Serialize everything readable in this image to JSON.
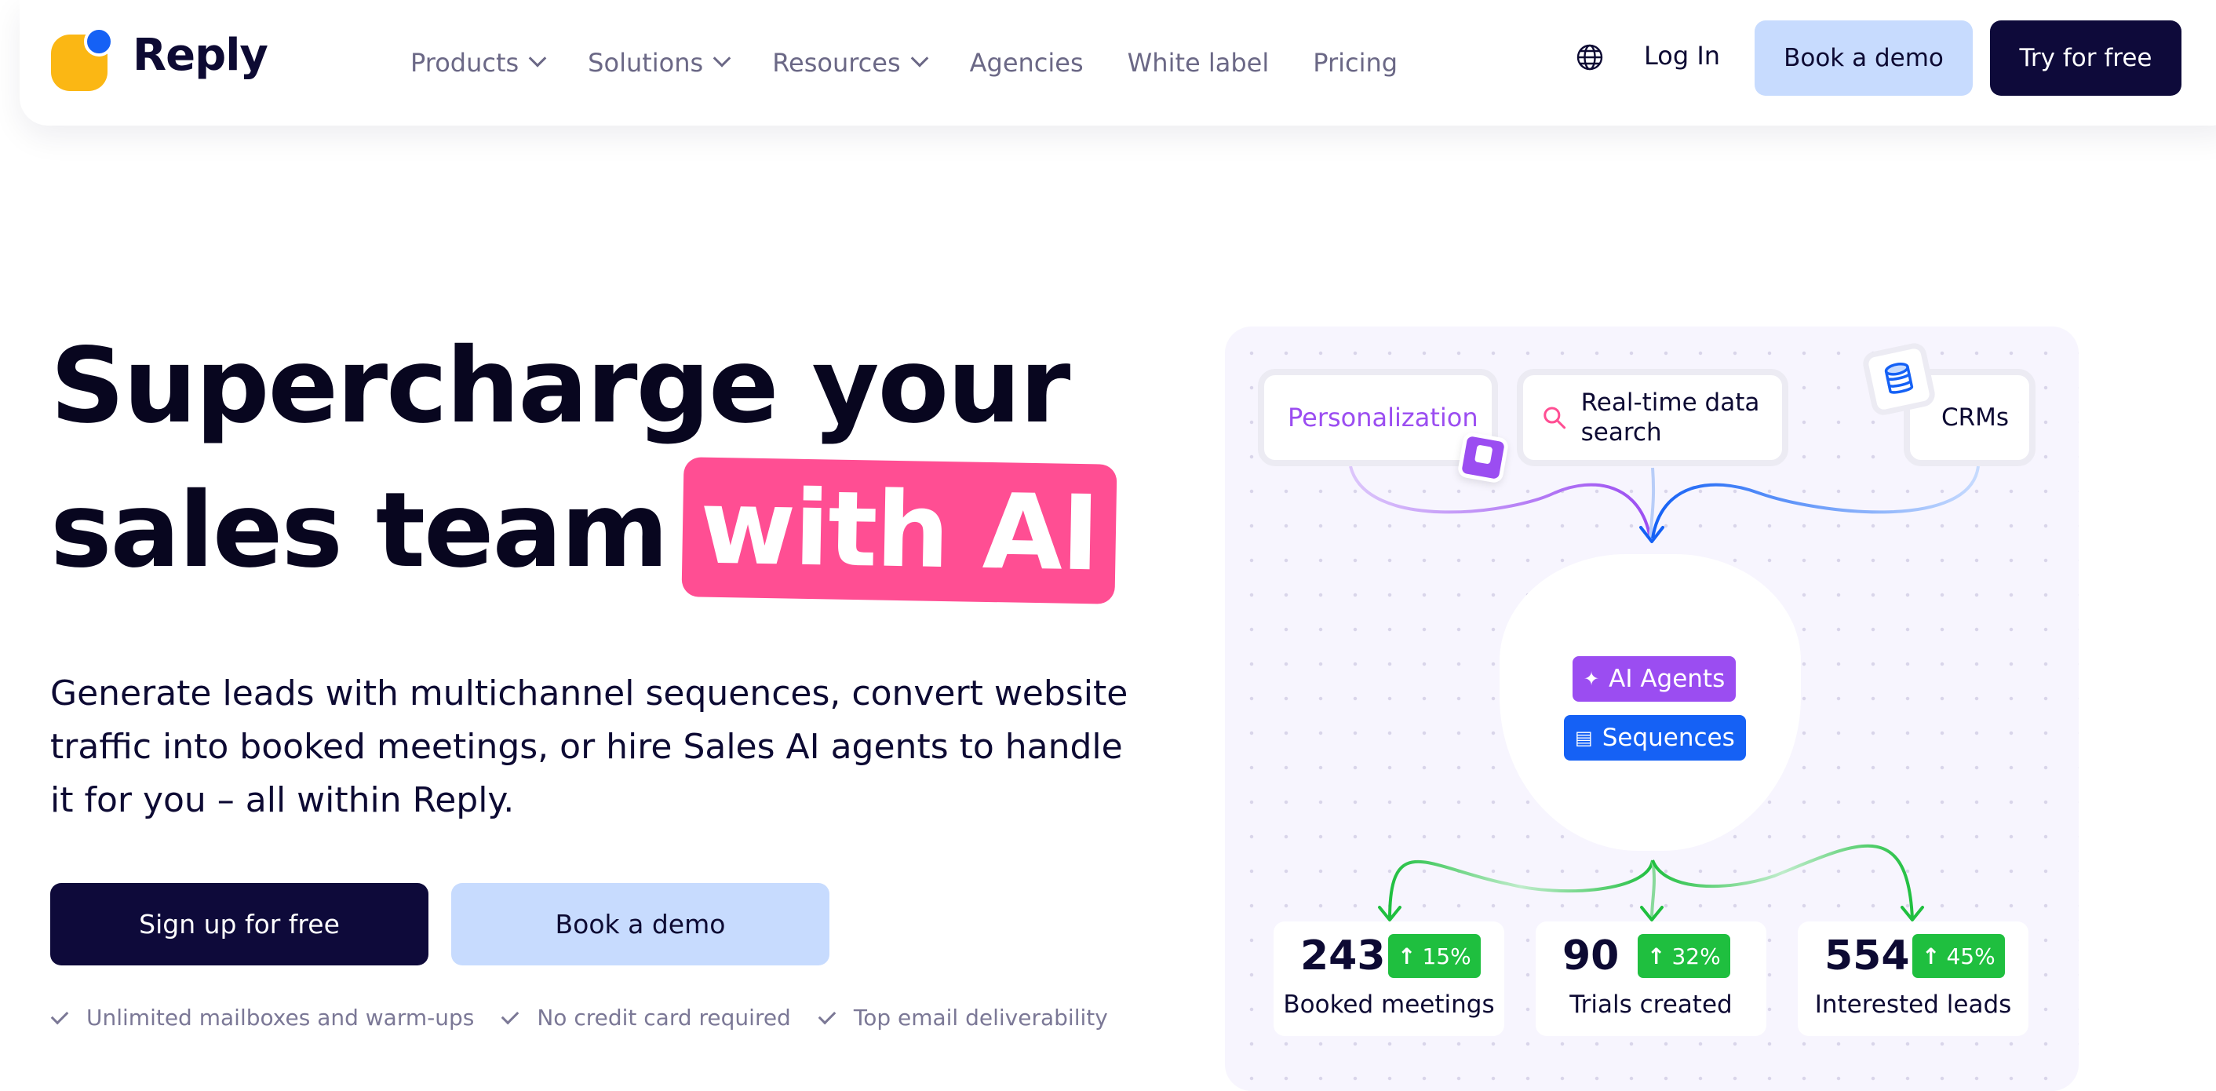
{
  "brand": {
    "name": "Reply",
    "logo_colors": {
      "yellow": "#fbb714",
      "blue": "#1561f5"
    }
  },
  "nav": {
    "items": [
      {
        "label": "Products",
        "has_dropdown": true
      },
      {
        "label": "Solutions",
        "has_dropdown": true
      },
      {
        "label": "Resources",
        "has_dropdown": true
      },
      {
        "label": "Agencies",
        "has_dropdown": false
      },
      {
        "label": "White label",
        "has_dropdown": false
      },
      {
        "label": "Pricing",
        "has_dropdown": false
      }
    ],
    "language_icon": "globe-icon",
    "login_label": "Log In",
    "demo_label": "Book a demo",
    "try_label": "Try for free"
  },
  "hero": {
    "title_line1": "Supercharge your",
    "title_line2": "sales team",
    "title_highlight": "with AI",
    "subtitle": "Generate leads with multichannel sequences, convert website traffic into booked meetings, or hire Sales AI agents to handle it for you – all within Reply.",
    "signup_label": "Sign up for free",
    "demo_label": "Book a demo",
    "checks": [
      "Unlimited mailboxes and warm-ups",
      "No credit card required",
      "Top email deliverability"
    ],
    "highlight_color": "#ff4e93"
  },
  "diagram": {
    "sources": {
      "personalization": "Personalization",
      "search": "Real-time data search",
      "crms": "CRMs"
    },
    "hub": {
      "agents": "AI Agents",
      "sequences": "Sequences"
    },
    "stats": [
      {
        "value": "243",
        "change": "15%",
        "label": "Booked meetings"
      },
      {
        "value": "90",
        "change": "32%",
        "label": "Trials created"
      },
      {
        "value": "554",
        "change": "45%",
        "label": "Interested leads"
      }
    ],
    "colors": {
      "purple": "#9b4df1",
      "blue": "#1561f5",
      "green": "#1fbf3f"
    }
  }
}
